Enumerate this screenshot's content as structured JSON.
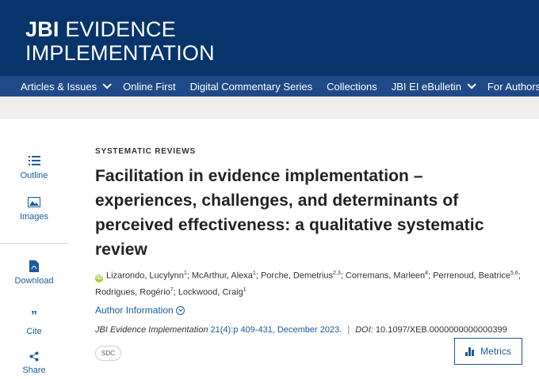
{
  "header": {
    "logo_bold": "JBI",
    "logo_rest_line1": " EVIDENCE",
    "logo_line2": "IMPLEMENTATION"
  },
  "nav": {
    "items": [
      {
        "label": "Articles & Issues",
        "has_dropdown": true
      },
      {
        "label": "Online First",
        "has_dropdown": false
      },
      {
        "label": "Digital Commentary Series",
        "has_dropdown": false
      },
      {
        "label": "Collections",
        "has_dropdown": false
      },
      {
        "label": "JBI EI eBulletin",
        "has_dropdown": true
      },
      {
        "label": "For Authors",
        "has_dropdown": false
      }
    ]
  },
  "sidebar": {
    "outline": "Outline",
    "images": "Images",
    "download": "Download",
    "cite": "Cite",
    "share": "Share"
  },
  "article": {
    "section": "SYSTEMATIC REVIEWS",
    "title": "Facilitation in evidence implementation – experiences, challenges, and determinants of perceived effectiveness: a qualitative systematic review",
    "authors": [
      {
        "name": "Lizarondo, Lucylynn",
        "sup": "1"
      },
      {
        "name": "McArthur, Alexa",
        "sup": "1"
      },
      {
        "name": "Porche, Demetrius",
        "sup": "2,3"
      },
      {
        "name": "Corremans, Marleen",
        "sup": "4"
      },
      {
        "name": "Perrenoud, Beatrice",
        "sup": "5,6"
      },
      {
        "name": "Rodrigues, Rogério",
        "sup": "7"
      },
      {
        "name": "Lockwood, Craig",
        "sup": "1"
      }
    ],
    "author_info": "Author Information",
    "journal": "JBI Evidence Implementation",
    "volume": "21(4):p 409-431, December 2023.",
    "doi_label": "DOI:",
    "doi": "10.1097/XEB.0000000000000399",
    "sdc": "SDC",
    "metrics": "Metrics"
  },
  "colors": {
    "header_bg": "#06346b",
    "nav_bg": "#1f4a87",
    "link": "#1a5a9a",
    "orcid": "#a6ce39"
  }
}
